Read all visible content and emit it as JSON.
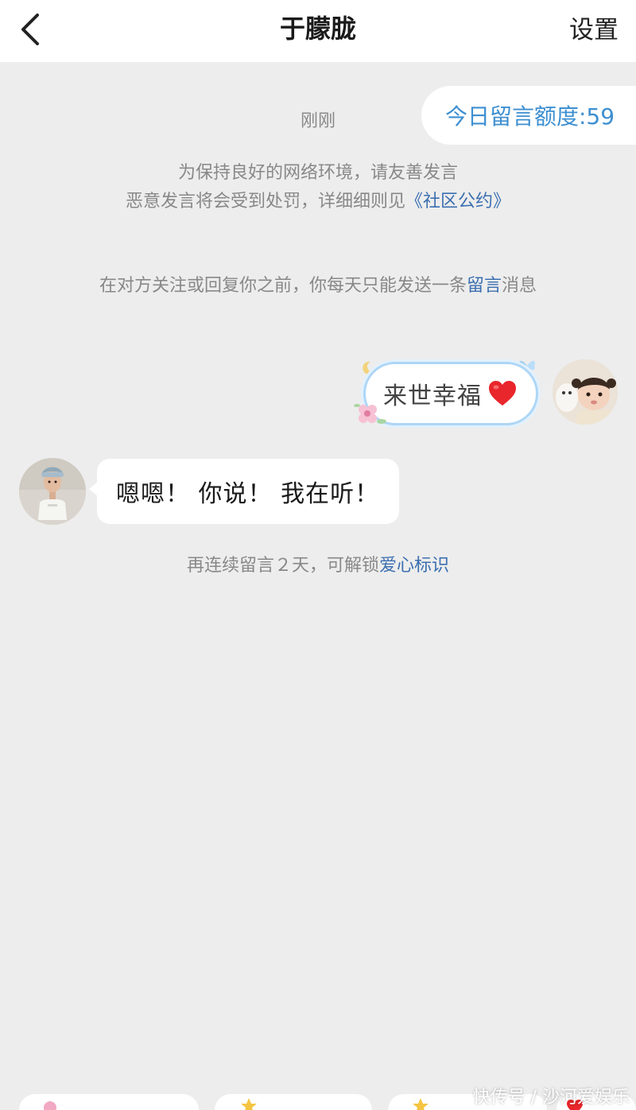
{
  "header": {
    "title": "于朦胧",
    "settings_label": "设置"
  },
  "quota": {
    "label": "今日留言额度:59"
  },
  "conversation": {
    "timestamp": "刚刚",
    "notice": {
      "line1": "为保持良好的网络环境，请友善发言",
      "line2_prefix": "恶意发言将会受到处罚，详细细则见",
      "line2_link": "《社区公约》"
    },
    "limit_notice": {
      "prefix": "在对方关注或回复你之前，你每天只能发送一条",
      "link": "留言",
      "suffix": "消息"
    },
    "messages": [
      {
        "side": "right",
        "text": "来世幸福"
      },
      {
        "side": "left",
        "text": "嗯嗯！ 你说！ 我在听！"
      }
    ],
    "streak_notice": {
      "prefix": "再连续留言２天，可解锁",
      "link": "爱心标识"
    }
  },
  "watermark": "快传号 / 沙河爱娱乐",
  "colors": {
    "accent_blue": "#3d8fd1",
    "link_blue": "#3b6fb0",
    "heart_red": "#e8262b",
    "background": "#ededed"
  }
}
